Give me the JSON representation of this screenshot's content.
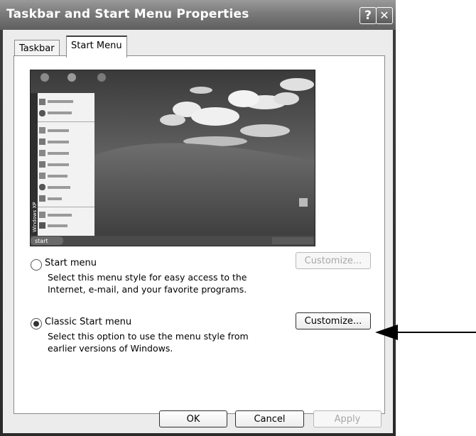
{
  "window": {
    "title": "Taskbar and Start Menu Properties",
    "help_glyph": "?",
    "close_glyph": "✕"
  },
  "tabs": [
    {
      "label": "Taskbar",
      "active": false
    },
    {
      "label": "Start Menu",
      "active": true
    }
  ],
  "preview": {
    "start_label": "start",
    "side_text": "Windows XP"
  },
  "options": {
    "start_menu": {
      "label": "Start menu",
      "description_line1": "Select this menu style for easy access to the",
      "description_line2": "Internet, e-mail, and your favorite programs.",
      "selected": false,
      "customize_label": "Customize...",
      "customize_enabled": false
    },
    "classic_start_menu": {
      "label": "Classic Start menu",
      "description_line1": "Select this option to use the menu style from",
      "description_line2": "earlier versions of Windows.",
      "selected": true,
      "customize_label": "Customize...",
      "customize_enabled": true
    }
  },
  "footer": {
    "ok_label": "OK",
    "cancel_label": "Cancel",
    "apply_label": "Apply"
  }
}
